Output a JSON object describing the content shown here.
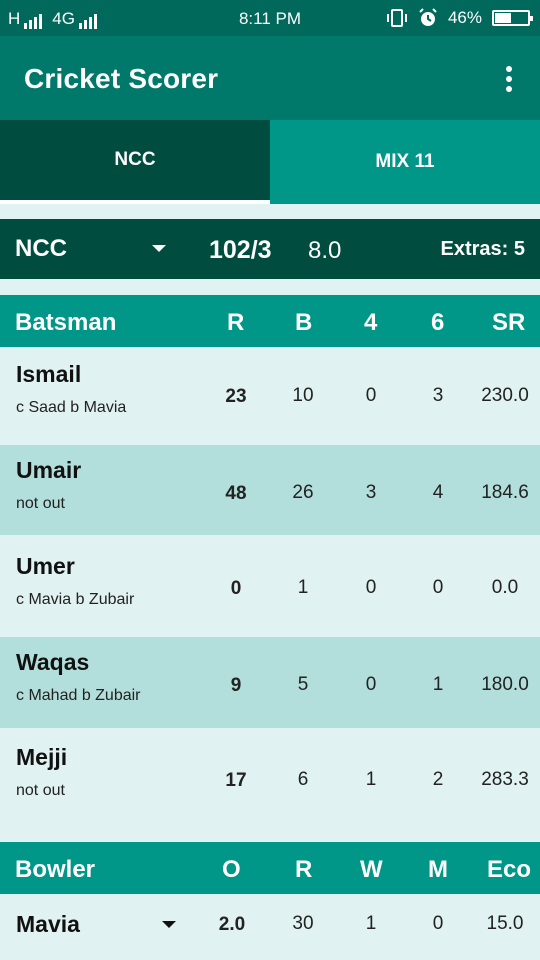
{
  "status": {
    "left_text_h": "H",
    "left_text_4g": "4G",
    "time": "8:11 PM",
    "battery": "46%",
    "battery_level": 0.46
  },
  "appbar": {
    "title": "Cricket Scorer",
    "menu_icon": "more-vert-icon"
  },
  "tabs": [
    {
      "label": "NCC",
      "selected": true
    },
    {
      "label": "MIX 11",
      "selected": false
    }
  ],
  "summary": {
    "team": "NCC",
    "score": "102/3",
    "overs": "8.0",
    "extras": "Extras: 5"
  },
  "batting": {
    "headers": [
      "Batsman",
      "R",
      "B",
      "4",
      "6",
      "SR"
    ],
    "rows": [
      {
        "name": "Ismail",
        "dismissal": "c Saad b Mavia",
        "r": "23",
        "b": "10",
        "fours": "0",
        "sixes": "3",
        "sr": "230.0"
      },
      {
        "name": "Umair",
        "dismissal": "not out",
        "r": "48",
        "b": "26",
        "fours": "3",
        "sixes": "4",
        "sr": "184.6"
      },
      {
        "name": "Umer",
        "dismissal": "c Mavia b Zubair",
        "r": "0",
        "b": "1",
        "fours": "0",
        "sixes": "0",
        "sr": "0.0"
      },
      {
        "name": "Waqas",
        "dismissal": "c Mahad b Zubair",
        "r": "9",
        "b": "5",
        "fours": "0",
        "sixes": "1",
        "sr": "180.0"
      },
      {
        "name": "Mejji",
        "dismissal": "not out",
        "r": "17",
        "b": "6",
        "fours": "1",
        "sixes": "2",
        "sr": "283.3"
      }
    ]
  },
  "bowling": {
    "headers": [
      "Bowler",
      "O",
      "R",
      "W",
      "M",
      "Eco"
    ],
    "rows": [
      {
        "name": "Mavia",
        "o": "2.0",
        "r": "30",
        "w": "1",
        "m": "0",
        "eco": "15.0"
      }
    ]
  },
  "colors": {
    "primary_dark": "#004d40",
    "primary": "#00796b",
    "accent": "#009688",
    "row_alt": "#b2dfdb",
    "background": "#e0f2f1"
  }
}
